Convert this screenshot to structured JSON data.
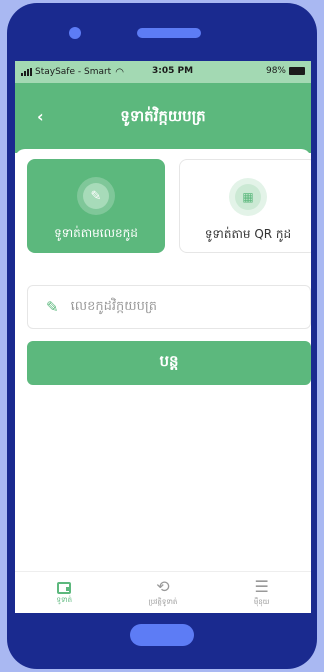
{
  "status": {
    "carrier": "StaySafe - Smart",
    "time": "3:05 PM",
    "battery": "98%"
  },
  "header": {
    "back_icon": "chevron-left-icon",
    "title": "ទូទាត់វិក្កយបត្រ"
  },
  "methods": [
    {
      "label": "ទូទាត់តាមលេខកូដ",
      "icon": "edit-icon",
      "selected": true
    },
    {
      "label": "ទូទាត់តាម QR កូដ",
      "icon": "qr-code-icon",
      "selected": false
    }
  ],
  "input": {
    "placeholder": "លេខកូដវិក្កយបត្រ",
    "icon": "pen-icon"
  },
  "continue_label": "បន្ត",
  "tabs": [
    {
      "label": "ទូទាត់",
      "icon": "wallet-icon",
      "active": true
    },
    {
      "label": "ប្រវត្តិទូទាត់",
      "icon": "history-icon",
      "active": false
    },
    {
      "label": "ម៉ឺនុយ",
      "icon": "menu-icon",
      "active": false
    }
  ],
  "colors": {
    "primary": "#5cb87d",
    "frame": "#1a2a8f",
    "accent": "#5d7cf5"
  }
}
